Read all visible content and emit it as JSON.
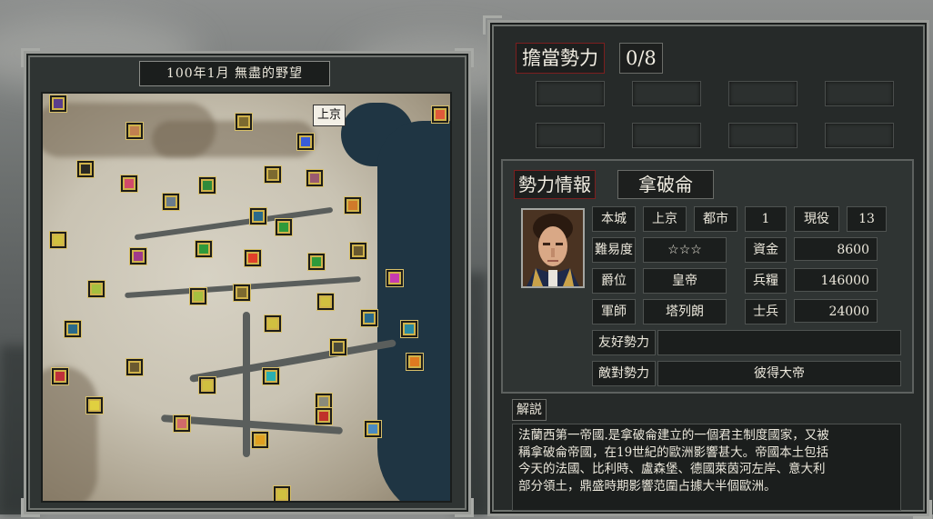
{
  "map": {
    "date_title": "100年1月 無盡的野望",
    "selected_city_label": "上京",
    "cities": [
      {
        "color": "#5a3e8c"
      },
      {
        "color": "#c08050"
      },
      {
        "color": "#e05a3a"
      },
      {
        "color": "#d24a6a"
      },
      {
        "color": "#7c6a30"
      },
      {
        "color": "#3a5cd8"
      },
      {
        "color": "#2a2a24"
      },
      {
        "color": "#7c6a30"
      },
      {
        "color": "#2f8a3a"
      },
      {
        "color": "#9a5a70"
      },
      {
        "color": "#6a7c8c"
      },
      {
        "color": "#d07a2a"
      },
      {
        "color": "#2a6a8a"
      },
      {
        "color": "#2f9a3a"
      },
      {
        "color": "#d0c040"
      },
      {
        "color": "#a03a8a"
      },
      {
        "color": "#2f9a3a"
      },
      {
        "color": "#e0402a"
      },
      {
        "color": "#2f9a3a"
      },
      {
        "color": "#6a5a30"
      },
      {
        "color": "#c83ab0"
      },
      {
        "color": "#a6c040"
      },
      {
        "color": "#a6c040"
      },
      {
        "color": "#7c6a30"
      },
      {
        "color": "#d0c040"
      },
      {
        "color": "#2a6a8a"
      },
      {
        "color": "#d0c040"
      },
      {
        "color": "#2a8aa0"
      },
      {
        "color": "#2a6a8a"
      },
      {
        "color": "#4a4a3a"
      },
      {
        "color": "#e07a20"
      },
      {
        "color": "#c0303a"
      },
      {
        "color": "#6a5a30"
      },
      {
        "color": "#d0c040"
      },
      {
        "color": "#2ab0b0"
      },
      {
        "color": "#8a8a7a"
      },
      {
        "color": "#e0d040"
      },
      {
        "color": "#d06a6a"
      },
      {
        "color": "#c0302a"
      },
      {
        "color": "#e0a020"
      },
      {
        "color": "#4a8ac0"
      },
      {
        "color": "#d0c040"
      }
    ]
  },
  "panel": {
    "title": "擔當勢力",
    "count": "0/8",
    "info_title": "勢力情報",
    "faction_name": "拿破侖",
    "fields": {
      "home_city_label": "本城",
      "home_city_value": "上京",
      "cities_label": "都市",
      "cities_value": "1",
      "active_label": "現役",
      "active_value": "13",
      "difficulty_label": "難易度",
      "difficulty_value": "☆☆☆",
      "funds_label": "資金",
      "funds_value": "8600",
      "rank_label": "爵位",
      "rank_value": "皇帝",
      "food_label": "兵糧",
      "food_value": "146000",
      "strategist_label": "軍師",
      "strategist_value": "塔列朗",
      "soldiers_label": "士兵",
      "soldiers_value": "24000",
      "friendly_label": "友好勢力",
      "friendly_value": "",
      "hostile_label": "敵對勢力",
      "hostile_value": "彼得大帝"
    },
    "desc_label": "解説",
    "desc_lines": [
      "法蘭西第一帝國.是拿破侖建立的一個君主制度國家，又被",
      "稱拿破侖帝國，在19世紀的歐洲影響甚大。帝國本土包括",
      "今天的法國、比利時、盧森堡、德國萊茵河左岸、意大利",
      "部分領土，鼎盛時期影響范圍占據大半個歐洲。"
    ]
  }
}
